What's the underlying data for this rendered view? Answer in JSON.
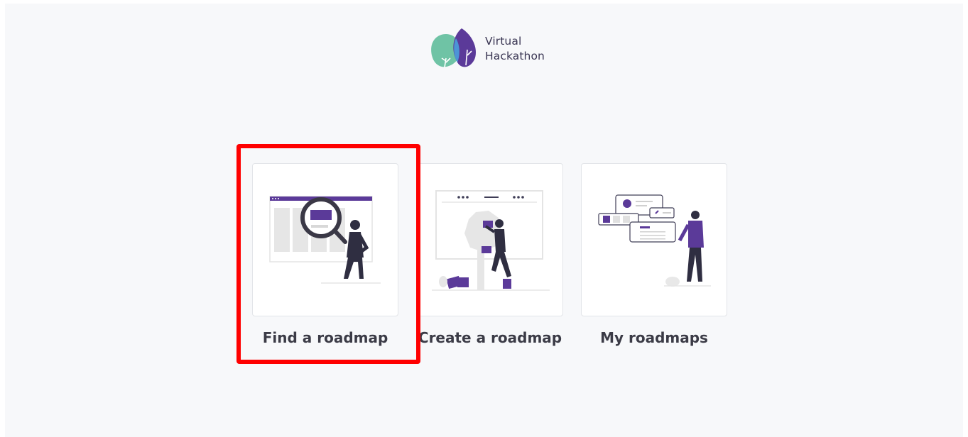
{
  "brand": {
    "line1": "Virtual",
    "line2": "Hackathon",
    "logo_icon": "two-leaf-logo-icon"
  },
  "options": [
    {
      "label": "Find a roadmap",
      "illustration": "magnifying-glass-person-illustration"
    },
    {
      "label": "Create a roadmap",
      "illustration": "building-tree-person-illustration"
    },
    {
      "label": "My roadmaps",
      "illustration": "person-with-cards-illustration"
    }
  ],
  "colors": {
    "page_background": "#f7f8fa",
    "accent": "#5b3a99",
    "leaf_green": "#6fc3a5",
    "highlight": "#ff0000",
    "text": "#3b3b46"
  }
}
